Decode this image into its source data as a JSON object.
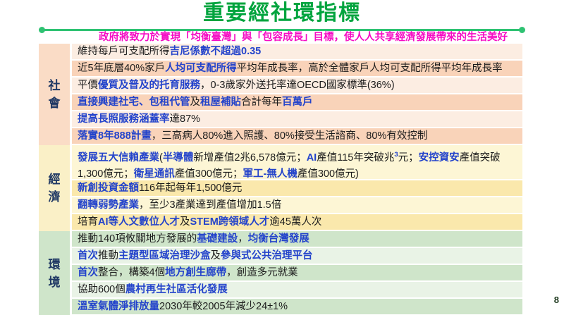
{
  "title": "重要經社環指標",
  "subtitle": "政府將致力於實現「均衡臺灣」與「包容成長」目標，使人人共享經濟發展帶來的生活美好",
  "page_number": "8",
  "colors": {
    "title_green": "#00A43E",
    "line_green": "#2EC272",
    "subtitle_pink": "#F50CC4",
    "emphasis_blue": "#2343CB",
    "label_navy": "#1F3864",
    "text_black": "#1C1C1C"
  },
  "table": {
    "groups": [
      {
        "id": "society",
        "label_chars": [
          "社",
          "會"
        ],
        "colors": {
          "label": "#FADCC6",
          "light": "#FCEDE2",
          "dark": "#F9D3B9"
        },
        "rows": [
          {
            "shade": "light",
            "segments": [
              {
                "t": "維持每戶可支配所得",
                "s": "plain"
              },
              {
                "t": "吉尼係數不超過0.35",
                "s": "em"
              }
            ]
          },
          {
            "shade": "dark",
            "segments": [
              {
                "t": "近5年底層40%家戶",
                "s": "plain"
              },
              {
                "t": "人均可支配所得",
                "s": "em"
              },
              {
                "t": "平均年成長率，高於全體家戶人均可支配所得平均年成長率",
                "s": "plain"
              }
            ]
          },
          {
            "shade": "light",
            "segments": [
              {
                "t": "平價",
                "s": "plain"
              },
              {
                "t": "優質及普及的托育服務",
                "s": "em"
              },
              {
                "t": "，0-3歲家外送托率達OECD國家標準(36%)",
                "s": "plain"
              }
            ]
          },
          {
            "shade": "dark",
            "segments": [
              {
                "t": "直接興建社宅、包租代管",
                "s": "em"
              },
              {
                "t": "及",
                "s": "plain"
              },
              {
                "t": "租屋補貼",
                "s": "em"
              },
              {
                "t": "合計每年",
                "s": "plain"
              },
              {
                "t": "百萬戶",
                "s": "em"
              }
            ]
          },
          {
            "shade": "light",
            "segments": [
              {
                "t": "提高長照服務涵蓋率",
                "s": "em"
              },
              {
                "t": "達87%",
                "s": "plain"
              }
            ]
          },
          {
            "shade": "dark",
            "segments": [
              {
                "t": "落實8年888計畫",
                "s": "em"
              },
              {
                "t": "，三高病人80%進入照護、80%接受生活諮商、80%有效控制",
                "s": "plain"
              }
            ]
          }
        ]
      },
      {
        "id": "economy",
        "label_chars": [
          "經",
          "濟"
        ],
        "colors": {
          "label": "#FAF0C7",
          "light": "#FDF6D5",
          "dark": "#FAE8AC"
        },
        "rows": [
          {
            "shade": "light",
            "tall": true,
            "segments": [
              {
                "t": "發展五大信賴產業",
                "s": "em"
              },
              {
                "t": "(",
                "s": "plain"
              },
              {
                "t": "半導體",
                "s": "em"
              },
              {
                "t": "新增產值2兆6,578億元；",
                "s": "plain"
              },
              {
                "t": "AI",
                "s": "em"
              },
              {
                "t": "產值115年突破兆",
                "s": "plain"
              },
              {
                "t": "3",
                "s": "sup"
              },
              {
                "t": "元；",
                "s": "plain"
              },
              {
                "t": "安控資安",
                "s": "em"
              },
              {
                "t": "產值突破1,300億元；",
                "s": "plain"
              },
              {
                "t": "衛星通訊",
                "s": "em"
              },
              {
                "t": "產值300億元；",
                "s": "plain"
              },
              {
                "t": "軍工-無人機",
                "s": "em"
              },
              {
                "t": "產值300億元)",
                "s": "plain"
              }
            ]
          },
          {
            "shade": "dark",
            "segments": [
              {
                "t": "新創投資金額",
                "s": "em"
              },
              {
                "t": "116年起每年1,500億元",
                "s": "plain"
              }
            ]
          },
          {
            "shade": "light",
            "segments": [
              {
                "t": "翻轉弱勢產業",
                "s": "em"
              },
              {
                "t": "，至少3產業達到產值增加1.5倍",
                "s": "plain"
              }
            ]
          },
          {
            "shade": "dark",
            "segments": [
              {
                "t": "培育",
                "s": "plain"
              },
              {
                "t": "AI等人文數位人才",
                "s": "em"
              },
              {
                "t": "及",
                "s": "plain"
              },
              {
                "t": "STEM跨領域人才",
                "s": "em"
              },
              {
                "t": "逾45萬人次",
                "s": "plain"
              }
            ]
          }
        ]
      },
      {
        "id": "environment",
        "label_chars": [
          "環",
          "境"
        ],
        "colors": {
          "label": "#CFE5CA",
          "light": "#E9F3E6",
          "dark": "#CFE5CA"
        },
        "rows": [
          {
            "shade": "dark",
            "segments": [
              {
                "t": "推動140項攸關地方發展的",
                "s": "plain"
              },
              {
                "t": "基礎建設",
                "s": "em"
              },
              {
                "t": "，",
                "s": "plain"
              },
              {
                "t": "均衡台灣發展",
                "s": "em"
              }
            ]
          },
          {
            "shade": "light",
            "segments": [
              {
                "t": "首次",
                "s": "em"
              },
              {
                "t": "推動",
                "s": "plain"
              },
              {
                "t": "主題型區域治理沙盒",
                "s": "em"
              },
              {
                "t": "及",
                "s": "plain"
              },
              {
                "t": "參與式公共治理平台",
                "s": "em"
              }
            ]
          },
          {
            "shade": "dark",
            "segments": [
              {
                "t": "首次",
                "s": "em"
              },
              {
                "t": "整合，構築4個",
                "s": "plain"
              },
              {
                "t": "地方創生廊帶",
                "s": "em"
              },
              {
                "t": "，創造多元就業",
                "s": "plain"
              }
            ]
          },
          {
            "shade": "light",
            "segments": [
              {
                "t": "協助600個",
                "s": "plain"
              },
              {
                "t": "農村再生社區活化發展",
                "s": "em"
              }
            ]
          },
          {
            "shade": "dark",
            "segments": [
              {
                "t": "溫室氣體淨排放量",
                "s": "em"
              },
              {
                "t": "2030年較2005年減少24±1%",
                "s": "plain"
              }
            ]
          }
        ]
      }
    ]
  }
}
